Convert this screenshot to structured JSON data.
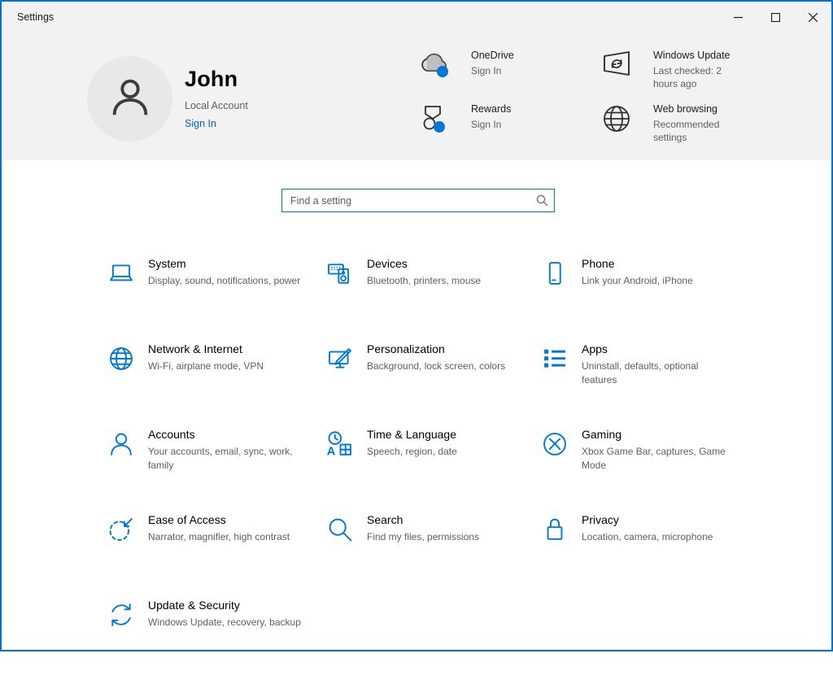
{
  "window": {
    "title": "Settings"
  },
  "header": {
    "user": {
      "name": "John",
      "account_type": "Local Account",
      "sign_in": "Sign In"
    },
    "quick": [
      {
        "title": "OneDrive",
        "subtitle": "Sign In"
      },
      {
        "title": "Rewards",
        "subtitle": "Sign In"
      },
      {
        "title": "Windows Update",
        "subtitle": "Last checked: 2 hours ago"
      },
      {
        "title": "Web browsing",
        "subtitle": "Recommended settings"
      }
    ]
  },
  "search": {
    "placeholder": "Find a setting"
  },
  "categories": [
    {
      "title": "System",
      "subtitle": "Display, sound, notifications, power"
    },
    {
      "title": "Devices",
      "subtitle": "Bluetooth, printers, mouse"
    },
    {
      "title": "Phone",
      "subtitle": "Link your Android, iPhone"
    },
    {
      "title": "Network & Internet",
      "subtitle": "Wi-Fi, airplane mode, VPN"
    },
    {
      "title": "Personalization",
      "subtitle": "Background, lock screen, colors"
    },
    {
      "title": "Apps",
      "subtitle": "Uninstall, defaults, optional features"
    },
    {
      "title": "Accounts",
      "subtitle": "Your accounts, email, sync, work, family"
    },
    {
      "title": "Time & Language",
      "subtitle": "Speech, region, date"
    },
    {
      "title": "Gaming",
      "subtitle": "Xbox Game Bar, captures, Game Mode"
    },
    {
      "title": "Ease of Access",
      "subtitle": "Narrator, magnifier, high contrast"
    },
    {
      "title": "Search",
      "subtitle": "Find my files, permissions"
    },
    {
      "title": "Privacy",
      "subtitle": "Location, camera, microphone"
    },
    {
      "title": "Update & Security",
      "subtitle": "Windows Update, recovery, backup"
    }
  ],
  "colors": {
    "accent": "#0078d7",
    "header_bg": "#f2f2f2",
    "subtitle_gray": "#5f5f5f",
    "link_blue": "#0067c0"
  }
}
